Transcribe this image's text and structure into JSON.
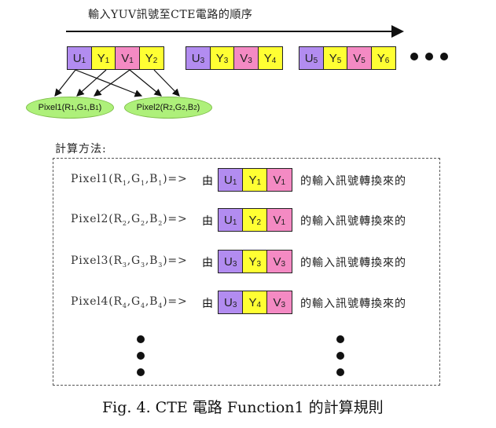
{
  "sequence_title": "輸入YUV訊號至CTE電路的順序",
  "groups": [
    {
      "cells": [
        {
          "letter": "U",
          "sub": "1",
          "color": "purple"
        },
        {
          "letter": "Y",
          "sub": "1",
          "color": "yellow"
        },
        {
          "letter": "V",
          "sub": "1",
          "color": "pink"
        },
        {
          "letter": "Y",
          "sub": "2",
          "color": "yellow"
        }
      ]
    },
    {
      "cells": [
        {
          "letter": "U",
          "sub": "3",
          "color": "purple"
        },
        {
          "letter": "Y",
          "sub": "3",
          "color": "yellow"
        },
        {
          "letter": "V",
          "sub": "3",
          "color": "pink"
        },
        {
          "letter": "Y",
          "sub": "4",
          "color": "yellow"
        }
      ]
    },
    {
      "cells": [
        {
          "letter": "U",
          "sub": "5",
          "color": "purple"
        },
        {
          "letter": "Y",
          "sub": "5",
          "color": "yellow"
        },
        {
          "letter": "V",
          "sub": "5",
          "color": "pink"
        },
        {
          "letter": "Y",
          "sub": "6",
          "color": "yellow"
        }
      ]
    }
  ],
  "ellipses": [
    {
      "name": "Pixel1",
      "args": [
        "R",
        "1",
        "G",
        "1",
        "B",
        "1"
      ]
    },
    {
      "name": "Pixel2",
      "args": [
        "R",
        "2",
        "G",
        "2",
        "B",
        "2"
      ]
    }
  ],
  "method_title": "計算方法:",
  "rows": [
    {
      "pixel": "Pixel1",
      "args": [
        "R",
        "1",
        "G",
        "1",
        "B",
        "1"
      ],
      "arrow": "=>",
      "from": "由",
      "cells": [
        {
          "letter": "U",
          "sub": "1",
          "color": "purple"
        },
        {
          "letter": "Y",
          "sub": "1",
          "color": "yellow"
        },
        {
          "letter": "V",
          "sub": "1",
          "color": "pink"
        }
      ],
      "suffix": "的輸入訊號轉換來的"
    },
    {
      "pixel": "Pixel2",
      "args": [
        "R",
        "2",
        "G",
        "2",
        "B",
        "2"
      ],
      "arrow": "=>",
      "from": "由",
      "cells": [
        {
          "letter": "U",
          "sub": "1",
          "color": "purple"
        },
        {
          "letter": "Y",
          "sub": "2",
          "color": "yellow"
        },
        {
          "letter": "V",
          "sub": "1",
          "color": "pink"
        }
      ],
      "suffix": "的輸入訊號轉換來的"
    },
    {
      "pixel": "Pixel3",
      "args": [
        "R",
        "3",
        "G",
        "3",
        "B",
        "3"
      ],
      "arrow": "=>",
      "from": "由",
      "cells": [
        {
          "letter": "U",
          "sub": "3",
          "color": "purple"
        },
        {
          "letter": "Y",
          "sub": "3",
          "color": "yellow"
        },
        {
          "letter": "V",
          "sub": "3",
          "color": "pink"
        }
      ],
      "suffix": "的輸入訊號轉換來的"
    },
    {
      "pixel": "Pixel4",
      "args": [
        "R",
        "4",
        "G",
        "4",
        "B",
        "4"
      ],
      "arrow": "=>",
      "from": "由",
      "cells": [
        {
          "letter": "U",
          "sub": "3",
          "color": "purple"
        },
        {
          "letter": "Y",
          "sub": "4",
          "color": "yellow"
        },
        {
          "letter": "V",
          "sub": "3",
          "color": "pink"
        }
      ],
      "suffix": "的輸入訊號轉換來的"
    }
  ],
  "caption": "Fig. 4. CTE  電路 Function1  的計算規則",
  "colors": {
    "purple": "#b28cf0",
    "yellow": "#ffff33",
    "pink": "#f48ac3",
    "ellipse": "#aef07a"
  }
}
